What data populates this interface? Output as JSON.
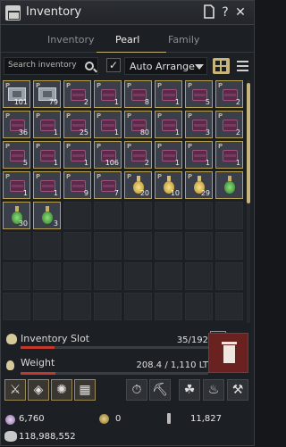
{
  "window": {
    "title": "Inventory"
  },
  "titlebar_buttons": {
    "help": "?",
    "close": "✕"
  },
  "tabs": [
    {
      "label": "Inventory"
    },
    {
      "label": "Pearl"
    },
    {
      "label": "Family"
    }
  ],
  "search": {
    "placeholder": "Search inventory"
  },
  "arrange": {
    "checked": "✓",
    "label": "Auto Arrange"
  },
  "slots": [
    {
      "type": "box",
      "p": "P",
      "qty": "101"
    },
    {
      "type": "box",
      "p": "P",
      "qty": "79"
    },
    {
      "type": "chest",
      "p": "P",
      "qty": "2"
    },
    {
      "type": "chest",
      "p": "P",
      "qty": "1"
    },
    {
      "type": "chest",
      "p": "P",
      "qty": "8"
    },
    {
      "type": "chest",
      "p": "P",
      "qty": "1"
    },
    {
      "type": "chest",
      "p": "P",
      "qty": "5"
    },
    {
      "type": "chest",
      "p": "P",
      "qty": "2"
    },
    {
      "type": "chest",
      "p": "P",
      "qty": "36"
    },
    {
      "type": "chest",
      "p": "P",
      "qty": "1"
    },
    {
      "type": "chest",
      "p": "P",
      "qty": "25"
    },
    {
      "type": "chest",
      "p": "P",
      "qty": "1"
    },
    {
      "type": "chest",
      "p": "P",
      "qty": "80"
    },
    {
      "type": "chest",
      "p": "P",
      "qty": "1"
    },
    {
      "type": "chest",
      "p": "P",
      "qty": "3"
    },
    {
      "type": "chest",
      "p": "P",
      "qty": "2"
    },
    {
      "type": "chest",
      "p": "P",
      "qty": "5"
    },
    {
      "type": "chest",
      "p": "P",
      "qty": "1"
    },
    {
      "type": "chest",
      "p": "P",
      "qty": "1"
    },
    {
      "type": "chest",
      "p": "P",
      "qty": "106"
    },
    {
      "type": "chest",
      "p": "P",
      "qty": "2"
    },
    {
      "type": "chest",
      "p": "P",
      "qty": "1"
    },
    {
      "type": "chest",
      "p": "P",
      "qty": "1"
    },
    {
      "type": "chest",
      "p": "P",
      "qty": "1"
    },
    {
      "type": "chest",
      "p": "P",
      "qty": "1"
    },
    {
      "type": "chest",
      "p": "P",
      "qty": "1"
    },
    {
      "type": "chest",
      "p": "P",
      "qty": "9"
    },
    {
      "type": "chest",
      "p": "P",
      "qty": "7"
    },
    {
      "type": "potion-y",
      "p": "P",
      "qty": "20"
    },
    {
      "type": "potion-y",
      "p": "P",
      "qty": "10"
    },
    {
      "type": "potion-y",
      "p": "P",
      "qty": "29"
    },
    {
      "type": "potion-g",
      "p": "",
      "qty": ""
    },
    {
      "type": "potion-g",
      "p": "",
      "qty": "30"
    },
    {
      "type": "potion-g",
      "p": "",
      "qty": "3"
    }
  ],
  "stats": {
    "inventory_slot": {
      "label": "Inventory Slot",
      "value": "35/192",
      "fill": 0.182
    },
    "weight": {
      "label": "Weight",
      "value": "208.4 / 1,110 LT",
      "fill": 0.188
    }
  },
  "tools_left": [
    "sword-upgrade",
    "crystal",
    "alchemy",
    "grid-combine"
  ],
  "tools_right": [
    "stopwatch",
    "pickaxe",
    "triskele",
    "genie-lamp",
    "hammer"
  ],
  "currency": {
    "pearls": "6,760",
    "coin": "0",
    "shard": "11,827",
    "silver": "118,988,552"
  },
  "colors": {
    "accent": "#c9b57c",
    "item_border": "#b8a24f",
    "trash_red": "#6a2220"
  }
}
